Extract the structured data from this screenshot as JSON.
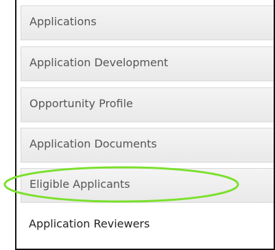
{
  "nav": {
    "items": [
      {
        "label": "Applications"
      },
      {
        "label": "Application Development"
      },
      {
        "label": "Opportunity Profile"
      },
      {
        "label": "Application Documents"
      },
      {
        "label": "Eligible Applicants"
      },
      {
        "label": "Application Reviewers"
      }
    ],
    "active_item": "Application Reviewers",
    "highlighted_item": "Eligible Applicants"
  },
  "colors": {
    "highlight_ellipse": "#7be02c",
    "tab_background": "#ececec",
    "active_tab_background": "#ffffff",
    "label_text": "#555555",
    "active_label_text": "#222222",
    "frame_border": "#111111"
  }
}
